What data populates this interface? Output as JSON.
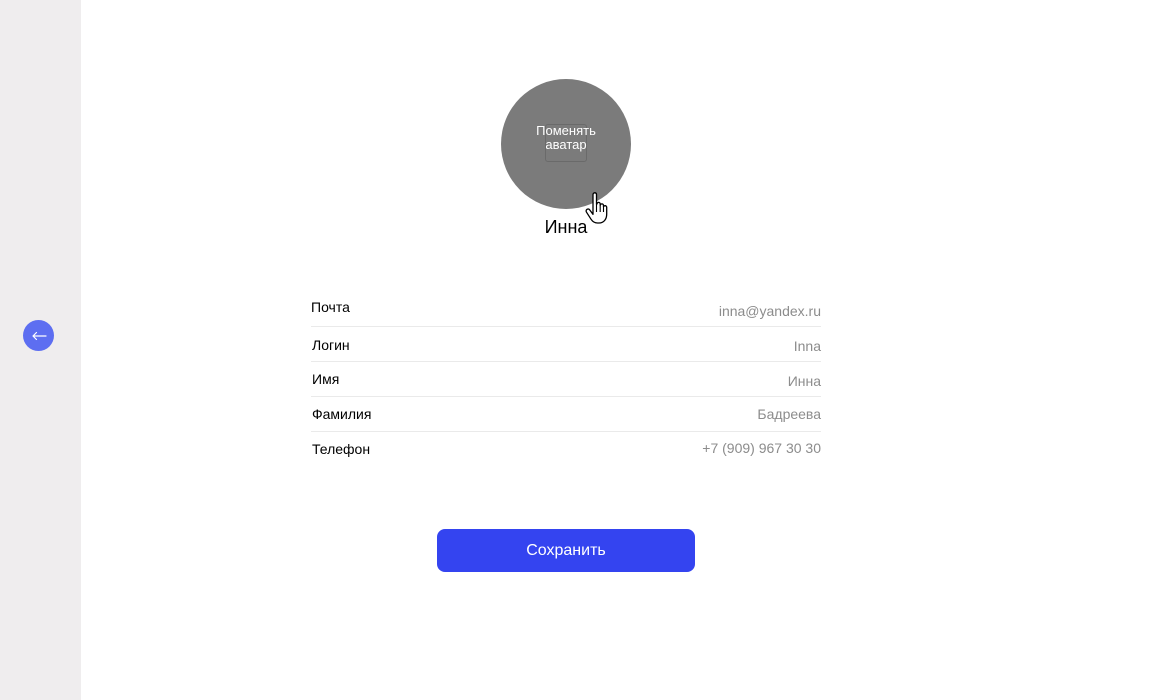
{
  "sidebar": {
    "back_icon": "arrow-left-icon"
  },
  "avatar": {
    "change_label_line1": "Поменять",
    "change_label_line2": "аватар",
    "cursor_icon": "hand-pointer-icon"
  },
  "profile": {
    "display_name": "Инна",
    "fields": [
      {
        "label": "Почта",
        "value": "inna@yandex.ru"
      },
      {
        "label": "Логин",
        "value": "Inna"
      },
      {
        "label": "Имя",
        "value": "Инна"
      },
      {
        "label": "Фамилия",
        "value": "Бадреева"
      },
      {
        "label": "Телефон",
        "value": "+7 (909) 967 30 30"
      }
    ]
  },
  "actions": {
    "save_label": "Сохранить"
  },
  "colors": {
    "accent": "#3444f0",
    "back_button": "#5d6ef1",
    "sidebar_bg": "#efedee",
    "avatar_bg": "#7b7b7b",
    "value_text": "#8c8c8c"
  }
}
